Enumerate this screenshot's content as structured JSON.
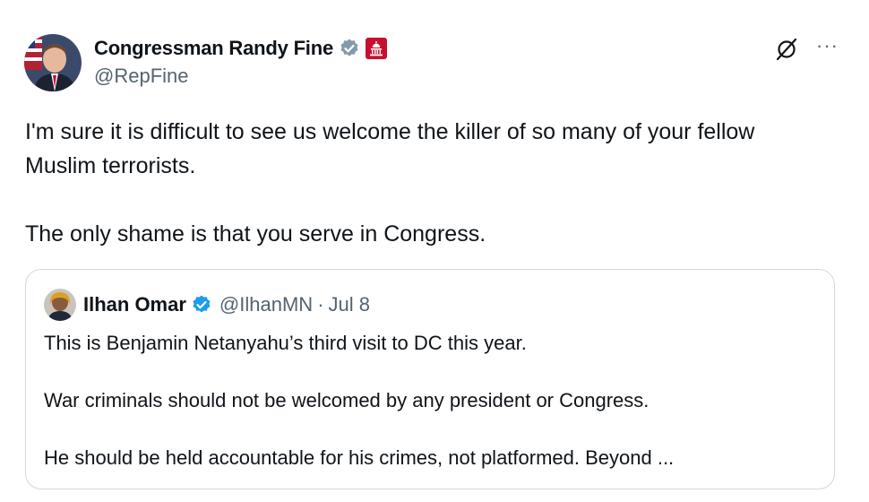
{
  "author": {
    "display_name": "Congressman Randy Fine",
    "handle": "@RepFine",
    "badges": [
      "verified-gray-icon",
      "us-congress-icon"
    ]
  },
  "post": {
    "text": "I'm sure it is difficult to see us welcome the killer of so many of your fellow Muslim terrorists.\n\nThe only shame is that you serve in Congress."
  },
  "actions": {
    "grok_icon": "grok-icon",
    "more_label": "···"
  },
  "quoted_post": {
    "display_name": "Ilhan Omar",
    "handle": "@IlhanMN",
    "separator": "·",
    "date": "Jul 8",
    "badge": "verified-blue-icon",
    "text": "This is Benjamin Netanyahu’s third visit to DC this year.\n\nWar criminals should not be welcomed by any president or Congress.\n\nHe should be held accountable for his crimes, not platformed. Beyond ..."
  },
  "colors": {
    "text": "#0f1419",
    "secondary": "#536471",
    "verified_gray": "#829aab",
    "verified_blue": "#1d9bf0",
    "congress_red": "#c8102e",
    "border": "#cfd9de"
  }
}
